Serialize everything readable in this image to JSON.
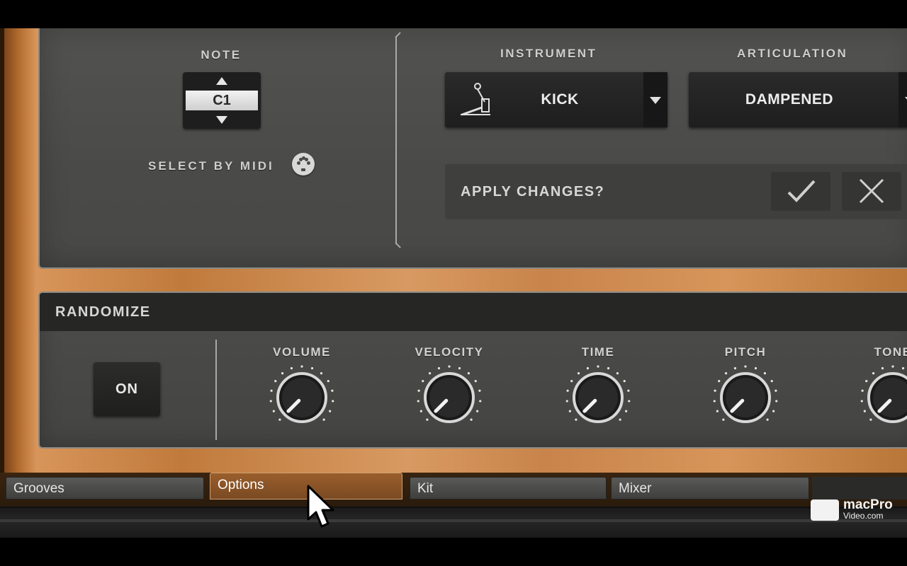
{
  "note": {
    "label": "NOTE",
    "value": "C1",
    "select_by_midi_label": "SELECT BY MIDI"
  },
  "instrument": {
    "label": "INSTRUMENT",
    "value": "KICK"
  },
  "articulation": {
    "label": "ARTICULATION",
    "value": "DAMPENED"
  },
  "apply": {
    "prompt": "APPLY CHANGES?"
  },
  "randomize": {
    "title": "RANDOMIZE",
    "on_label": "ON",
    "knobs": [
      {
        "label": "VOLUME"
      },
      {
        "label": "VELOCITY"
      },
      {
        "label": "TIME"
      },
      {
        "label": "PITCH"
      },
      {
        "label": "TONE"
      }
    ]
  },
  "tabs": [
    {
      "label": "Grooves",
      "active": false
    },
    {
      "label": "Options",
      "active": true
    },
    {
      "label": "Kit",
      "active": false
    },
    {
      "label": "Mixer",
      "active": false
    }
  ],
  "watermark": {
    "brand": "macPro",
    "site": "Video.com"
  },
  "colors": {
    "panel": "#4a4a48",
    "wood": "#c8844a",
    "active_tab": "#8a5428",
    "text": "#d6d6d6"
  }
}
